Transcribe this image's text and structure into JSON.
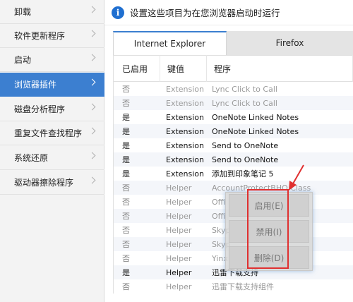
{
  "sidebar": {
    "items": [
      {
        "label": "卸载",
        "active": false
      },
      {
        "label": "软件更新程序",
        "active": false
      },
      {
        "label": "启动",
        "active": false
      },
      {
        "label": "浏览器插件",
        "active": true
      },
      {
        "label": "磁盘分析程序",
        "active": false
      },
      {
        "label": "重复文件查找程序",
        "active": false
      },
      {
        "label": "系统还原",
        "active": false
      },
      {
        "label": "驱动器擦除程序",
        "active": false
      }
    ]
  },
  "infobar": {
    "icon": "info-icon",
    "icon_glyph": "i",
    "text": "设置这些项目为在您浏览器启动时运行"
  },
  "tabs": [
    {
      "label": "Internet Explorer",
      "active": true
    },
    {
      "label": "Firefox",
      "active": false
    }
  ],
  "table": {
    "headers": [
      "已启用",
      "键值",
      "程序"
    ],
    "rows": [
      {
        "enabled": "否",
        "key": "Extension",
        "program": "Lync Click to Call"
      },
      {
        "enabled": "否",
        "key": "Extension",
        "program": "Lync Click to Call"
      },
      {
        "enabled": "是",
        "key": "Extension",
        "program": "OneNote Linked Notes"
      },
      {
        "enabled": "是",
        "key": "Extension",
        "program": "OneNote Linked Notes"
      },
      {
        "enabled": "是",
        "key": "Extension",
        "program": "Send to OneNote"
      },
      {
        "enabled": "是",
        "key": "Extension",
        "program": "Send to OneNote"
      },
      {
        "enabled": "是",
        "key": "Extension",
        "program": "添加到印象笔记 5"
      },
      {
        "enabled": "否",
        "key": "Helper",
        "program": "AccountProtectBHO Class"
      },
      {
        "enabled": "否",
        "key": "Helper",
        "program": "Offi"
      },
      {
        "enabled": "否",
        "key": "Helper",
        "program": "Offi"
      },
      {
        "enabled": "否",
        "key": "Helper",
        "program": "Skyp"
      },
      {
        "enabled": "否",
        "key": "Helper",
        "program": "Skyp"
      },
      {
        "enabled": "否",
        "key": "Helper",
        "program": "Yinx"
      },
      {
        "enabled": "是",
        "key": "Helper",
        "program": "迅雷下载支持"
      },
      {
        "enabled": "否",
        "key": "Helper",
        "program": "迅雷下载支持组件"
      }
    ]
  },
  "context_menu": {
    "items": [
      {
        "label": "启用(E)"
      },
      {
        "label": "禁用(I)"
      },
      {
        "label": "删除(D)"
      }
    ]
  },
  "annotation": {
    "color": "#e03030"
  },
  "colors": {
    "accent": "#3c7fd0",
    "info_icon": "#1f6fd0"
  }
}
